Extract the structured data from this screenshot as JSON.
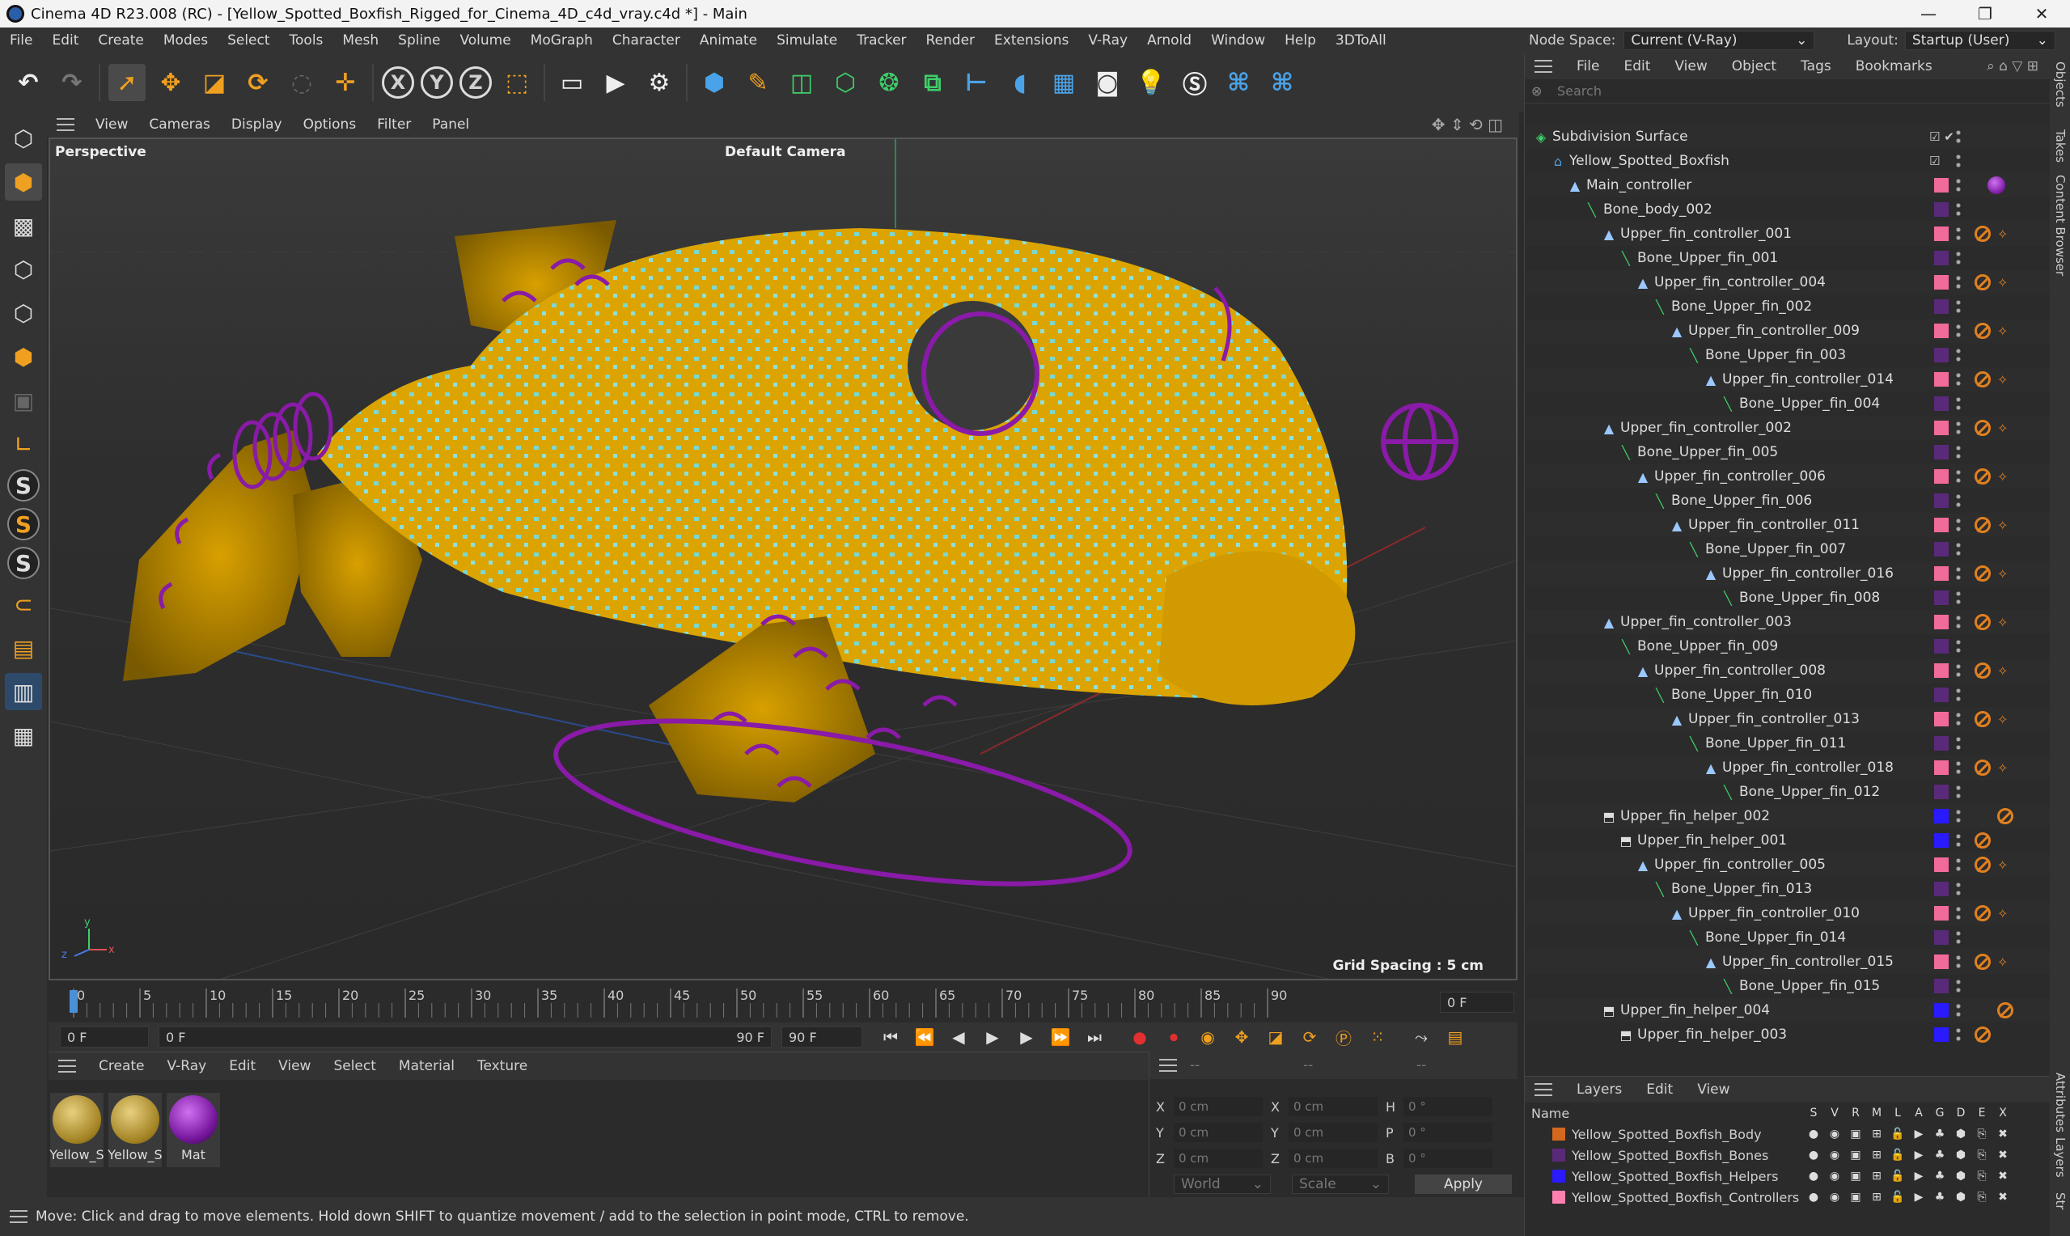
{
  "window": {
    "title": "Cinema 4D R23.008 (RC) - [Yellow_Spotted_Boxfish_Rigged_for_Cinema_4D_c4d_vray.c4d *] - Main",
    "controls": [
      "—",
      "❐",
      "✕"
    ]
  },
  "menu": [
    "File",
    "Edit",
    "Create",
    "Modes",
    "Select",
    "Tools",
    "Mesh",
    "Spline",
    "Volume",
    "MoGraph",
    "Character",
    "Animate",
    "Simulate",
    "Tracker",
    "Render",
    "Extensions",
    "V-Ray",
    "Arnold",
    "Window",
    "Help",
    "3DToAll"
  ],
  "nodespace": {
    "label": "Node Space:",
    "value": "Current (V-Ray)",
    "layout_label": "Layout:",
    "layout_value": "Startup (User)"
  },
  "viewport": {
    "menu": [
      "View",
      "Cameras",
      "Display",
      "Options",
      "Filter",
      "Panel"
    ],
    "projection": "Perspective",
    "camera": "Default Camera",
    "grid_spacing": "Grid Spacing : 5 cm",
    "colors": {
      "fish": "#e0a800",
      "rig": "#8a1aa8",
      "spots": "#6ee0e0"
    }
  },
  "timeline": {
    "ticks": [
      "0",
      "5",
      "10",
      "15",
      "20",
      "25",
      "30",
      "35",
      "40",
      "45",
      "50",
      "55",
      "60",
      "65",
      "70",
      "75",
      "80",
      "85",
      "90"
    ],
    "current_frame": "0 F",
    "start": "0 F",
    "range_start": "0 F",
    "range_end": "90 F",
    "end": "90 F"
  },
  "materials": {
    "menu": [
      "Create",
      "V-Ray",
      "Edit",
      "View",
      "Select",
      "Material",
      "Texture"
    ],
    "items": [
      {
        "name": "Yellow_S",
        "color": "#c9a030"
      },
      {
        "name": "Yellow_S",
        "color": "#c9a030"
      },
      {
        "name": "Mat",
        "color": "#7a1aa0"
      }
    ]
  },
  "attributes": {
    "header_values": [
      "--",
      "--",
      "--"
    ],
    "rows": [
      {
        "a": "X",
        "av": "0 cm",
        "b": "X",
        "bv": "0 cm",
        "c": "H",
        "cv": "0 °"
      },
      {
        "a": "Y",
        "av": "0 cm",
        "b": "Y",
        "bv": "0 cm",
        "c": "P",
        "cv": "0 °"
      },
      {
        "a": "Z",
        "av": "0 cm",
        "b": "Z",
        "bv": "0 cm",
        "c": "B",
        "cv": "0 °"
      }
    ],
    "coord_mode": "World",
    "size_mode": "Scale",
    "apply": "Apply"
  },
  "status": "Move: Click and drag to move elements. Hold down SHIFT to quantize movement / add to the selection in point mode, CTRL to remove.",
  "objects": {
    "menu": [
      "File",
      "Edit",
      "View",
      "Object",
      "Tags",
      "Bookmarks"
    ],
    "search_placeholder": "Search",
    "tree": [
      {
        "name": "Subdivision Surface",
        "depth": 0,
        "kind": "subd"
      },
      {
        "name": "Yellow_Spotted_Boxfish",
        "depth": 1,
        "kind": "null"
      },
      {
        "name": "Main_controller",
        "depth": 2,
        "kind": "ctrl"
      },
      {
        "name": "Bone_body_002",
        "depth": 3,
        "kind": "bone"
      },
      {
        "name": "Upper_fin_controller_001",
        "depth": 4,
        "kind": "ctrl"
      },
      {
        "name": "Bone_Upper_fin_001",
        "depth": 5,
        "kind": "bone"
      },
      {
        "name": "Upper_fin_controller_004",
        "depth": 6,
        "kind": "ctrl"
      },
      {
        "name": "Bone_Upper_fin_002",
        "depth": 7,
        "kind": "bone"
      },
      {
        "name": "Upper_fin_controller_009",
        "depth": 8,
        "kind": "ctrl"
      },
      {
        "name": "Bone_Upper_fin_003",
        "depth": 9,
        "kind": "bone"
      },
      {
        "name": "Upper_fin_controller_014",
        "depth": 10,
        "kind": "ctrl"
      },
      {
        "name": "Bone_Upper_fin_004",
        "depth": 11,
        "kind": "bone"
      },
      {
        "name": "Upper_fin_controller_002",
        "depth": 4,
        "kind": "ctrl"
      },
      {
        "name": "Bone_Upper_fin_005",
        "depth": 5,
        "kind": "bone"
      },
      {
        "name": "Upper_fin_controller_006",
        "depth": 6,
        "kind": "ctrl"
      },
      {
        "name": "Bone_Upper_fin_006",
        "depth": 7,
        "kind": "bone"
      },
      {
        "name": "Upper_fin_controller_011",
        "depth": 8,
        "kind": "ctrl"
      },
      {
        "name": "Bone_Upper_fin_007",
        "depth": 9,
        "kind": "bone"
      },
      {
        "name": "Upper_fin_controller_016",
        "depth": 10,
        "kind": "ctrl"
      },
      {
        "name": "Bone_Upper_fin_008",
        "depth": 11,
        "kind": "bone"
      },
      {
        "name": "Upper_fin_controller_003",
        "depth": 4,
        "kind": "ctrl"
      },
      {
        "name": "Bone_Upper_fin_009",
        "depth": 5,
        "kind": "bone"
      },
      {
        "name": "Upper_fin_controller_008",
        "depth": 6,
        "kind": "ctrl"
      },
      {
        "name": "Bone_Upper_fin_010",
        "depth": 7,
        "kind": "bone"
      },
      {
        "name": "Upper_fin_controller_013",
        "depth": 8,
        "kind": "ctrl"
      },
      {
        "name": "Bone_Upper_fin_011",
        "depth": 9,
        "kind": "bone"
      },
      {
        "name": "Upper_fin_controller_018",
        "depth": 10,
        "kind": "ctrl"
      },
      {
        "name": "Bone_Upper_fin_012",
        "depth": 11,
        "kind": "bone"
      },
      {
        "name": "Upper_fin_helper_002",
        "depth": 4,
        "kind": "helper"
      },
      {
        "name": "Upper_fin_helper_001",
        "depth": 5,
        "kind": "helper"
      },
      {
        "name": "Upper_fin_controller_005",
        "depth": 6,
        "kind": "ctrl"
      },
      {
        "name": "Bone_Upper_fin_013",
        "depth": 7,
        "kind": "bone"
      },
      {
        "name": "Upper_fin_controller_010",
        "depth": 8,
        "kind": "ctrl"
      },
      {
        "name": "Bone_Upper_fin_014",
        "depth": 9,
        "kind": "bone"
      },
      {
        "name": "Upper_fin_controller_015",
        "depth": 10,
        "kind": "ctrl"
      },
      {
        "name": "Bone_Upper_fin_015",
        "depth": 11,
        "kind": "bone"
      },
      {
        "name": "Upper_fin_helper_004",
        "depth": 4,
        "kind": "helper"
      },
      {
        "name": "Upper_fin_helper_003",
        "depth": 5,
        "kind": "helper"
      }
    ]
  },
  "layers": {
    "menu": [
      "Layers",
      "Edit",
      "View"
    ],
    "columns": [
      "Name",
      "S",
      "V",
      "R",
      "M",
      "L",
      "A",
      "G",
      "D",
      "E",
      "X"
    ],
    "items": [
      {
        "name": "Yellow_Spotted_Boxfish_Body",
        "color": "#d2691e"
      },
      {
        "name": "Yellow_Spotted_Boxfish_Bones",
        "color": "#5a2a7a"
      },
      {
        "name": "Yellow_Spotted_Boxfish_Helpers",
        "color": "#2a1aff"
      },
      {
        "name": "Yellow_Spotted_Boxfish_Controllers",
        "color": "#ff80b0"
      }
    ]
  },
  "sidetabs": [
    "Objects",
    "Takes",
    "Content Browser",
    "Attributes",
    "Layers",
    "Str"
  ]
}
